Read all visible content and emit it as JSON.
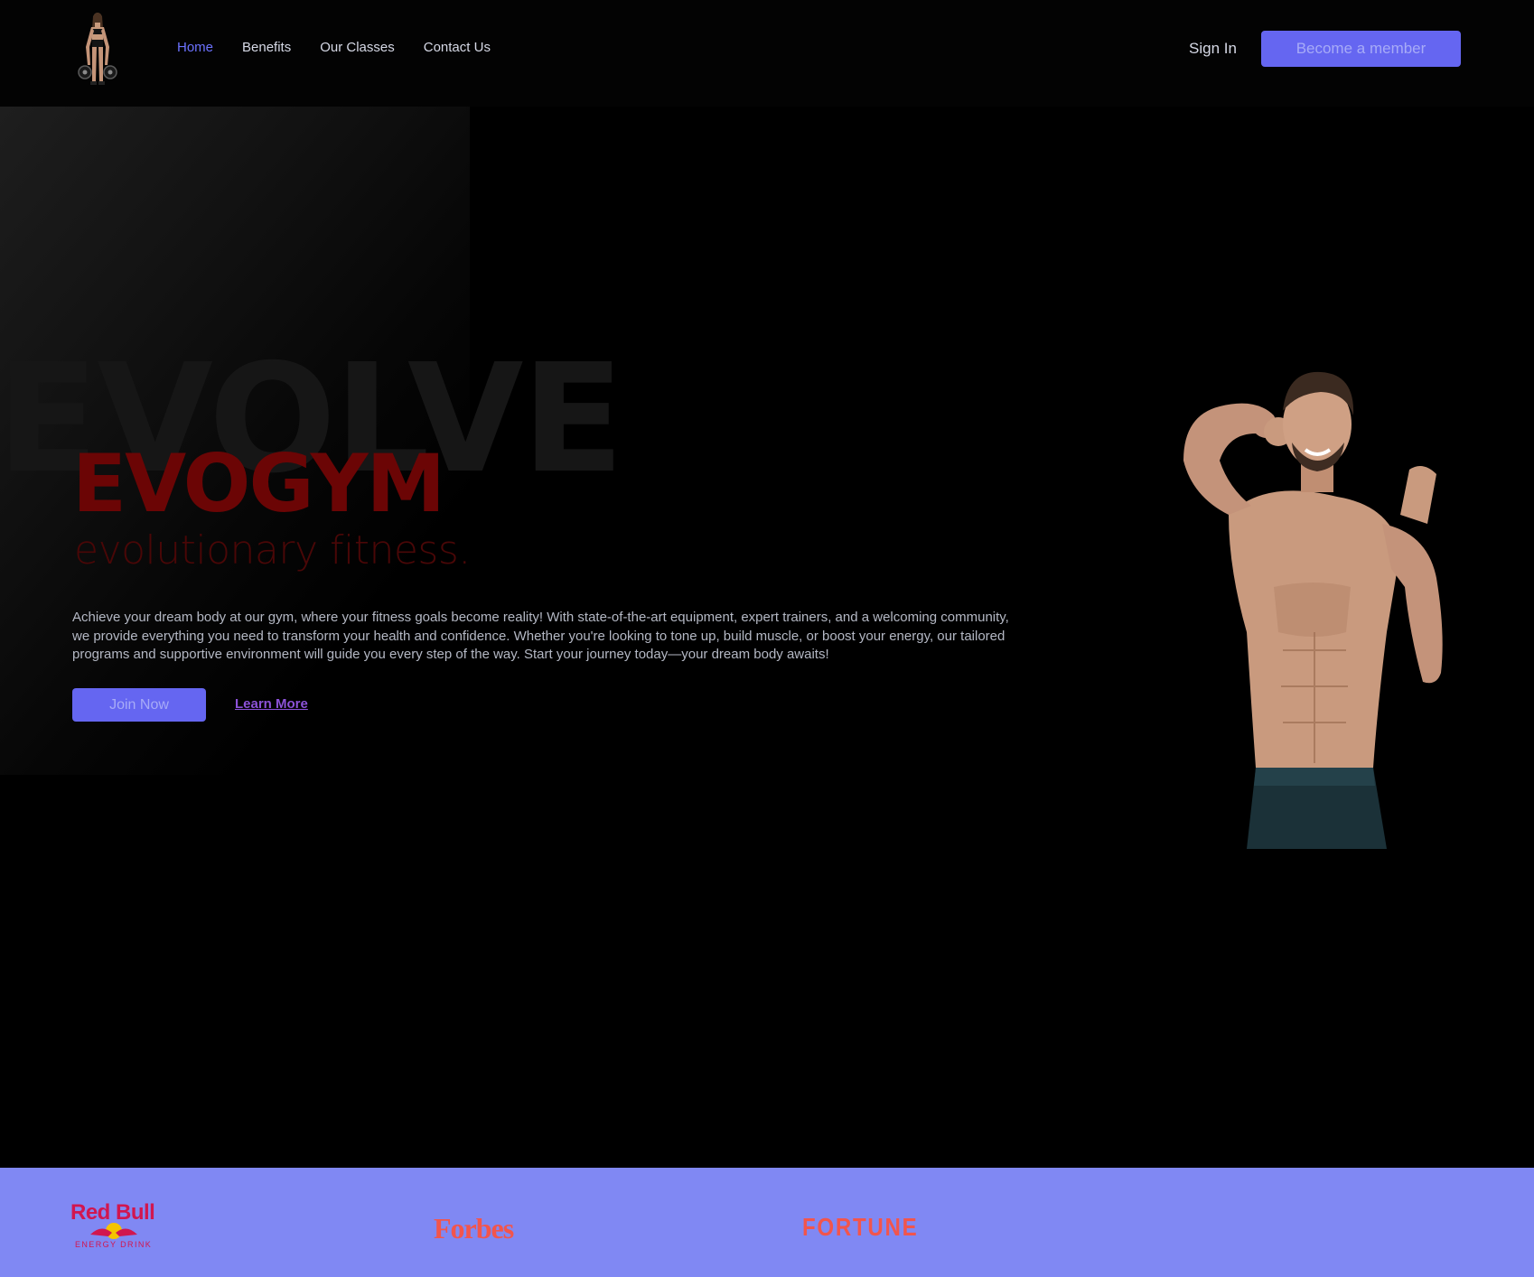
{
  "nav": {
    "links": [
      {
        "label": "Home",
        "active": true
      },
      {
        "label": "Benefits",
        "active": false
      },
      {
        "label": "Our Classes",
        "active": false
      },
      {
        "label": "Contact Us",
        "active": false
      }
    ],
    "sign_in": "Sign In",
    "cta": "Become a member"
  },
  "hero": {
    "background_word": "EVOLVE",
    "brand": "EVOGYM",
    "tagline": "evolutionary fitness.",
    "description": "Achieve your dream body at our gym, where your fitness goals become reality! With state-of-the-art equipment, expert trainers, and a welcoming community, we provide everything you need to transform your health and confidence. Whether you're looking to tone up, build muscle, or boost your energy, our tailored programs and supportive environment will guide you every step of the way. Start your journey today—your dream body awaits!",
    "primary_button": "Join Now",
    "secondary_link": "Learn More"
  },
  "sponsors": {
    "redbull": {
      "name": "Red Bull",
      "sub": "ENERGY DRINK"
    },
    "forbes": "Forbes",
    "fortune": "FORTUNE"
  },
  "colors": {
    "accent": "#6566f1",
    "active_link": "#6c72ff",
    "brand_red": "#6b0505",
    "sponsor_bar": "#8088f3",
    "sponsor_logo": "#f2554c"
  }
}
